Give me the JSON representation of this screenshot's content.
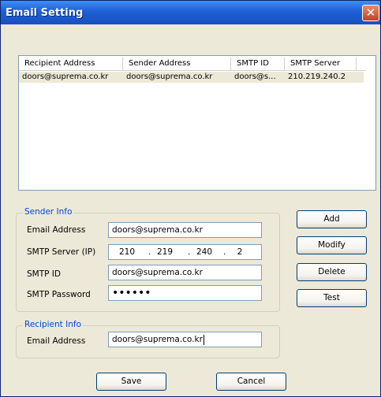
{
  "window": {
    "title": "Email Setting",
    "close_glyph": "✕"
  },
  "list": {
    "columns": [
      "Recipient Address",
      "Sender Address",
      "SMTP ID",
      "SMTP Server"
    ],
    "rows": [
      [
        "doors@suprema.co.kr",
        "doors@suprema.co.kr",
        "doors@s...",
        "210.219.240.2"
      ]
    ]
  },
  "sender": {
    "group_label": "Sender Info",
    "email_label": "Email Address",
    "email_value": "doors@suprema.co.kr",
    "smtp_server_label": "SMTP Server (IP)",
    "ip": [
      "210",
      "219",
      "240",
      "2"
    ],
    "ip_dot": ".",
    "smtp_id_label": "SMTP ID",
    "smtp_id_value": "doors@suprema.co.kr",
    "smtp_password_label": "SMTP Password",
    "smtp_password_value": "••••••"
  },
  "recipient": {
    "group_label": "Recipient Info",
    "email_label": "Email Address",
    "email_value": "doors@suprema.co.kr"
  },
  "buttons": {
    "add": "Add",
    "modify": "Modify",
    "delete": "Delete",
    "test": "Test",
    "save": "Save",
    "cancel": "Cancel"
  },
  "colors": {
    "titlebar": "#1f5fd6",
    "group_label": "#0046d5",
    "dialog_bg": "#ece9d8"
  }
}
